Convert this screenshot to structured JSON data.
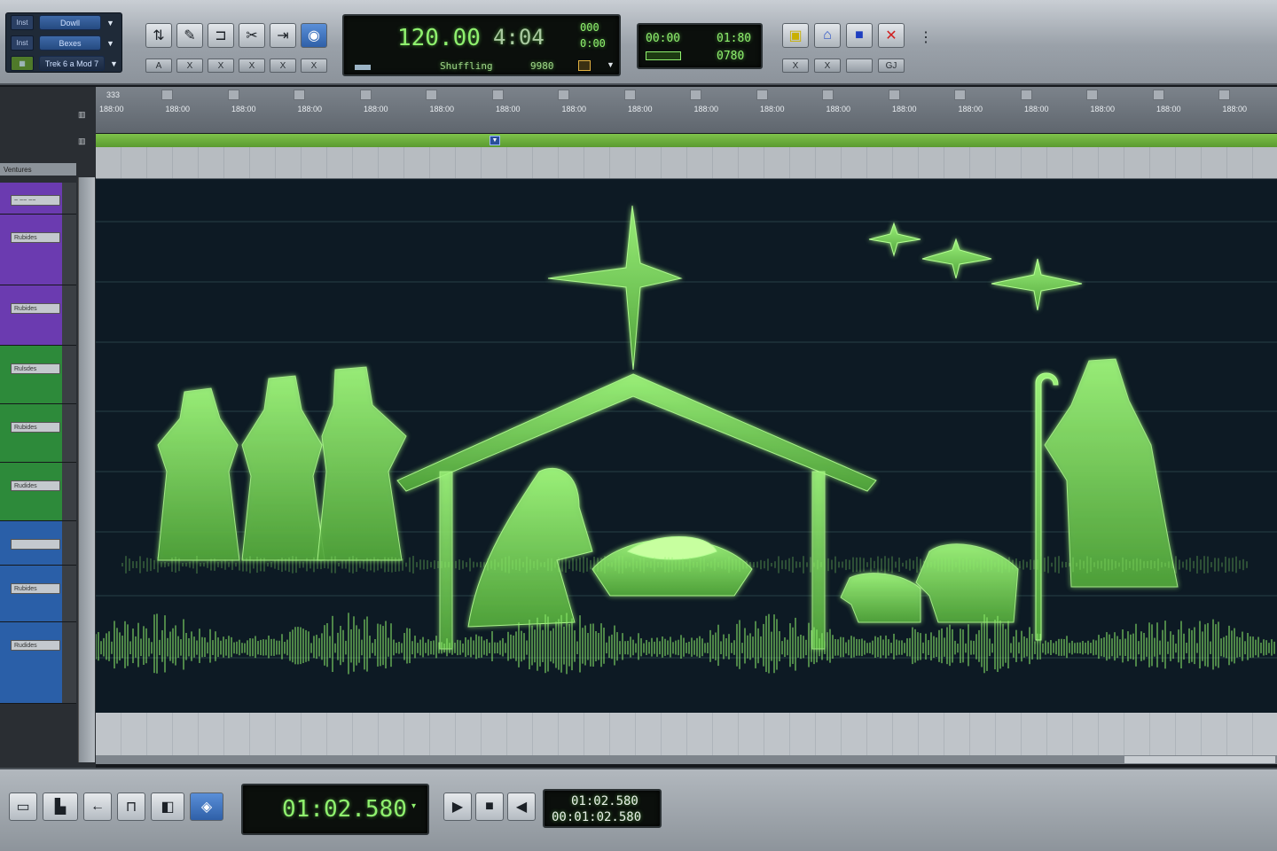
{
  "toolbar": {
    "rows": [
      {
        "tag": "Inst",
        "pill": "Dowll"
      },
      {
        "tag": "Inst",
        "pill": "Bexes"
      },
      {
        "tag": "",
        "pill": "Trek 6 a Mod 7"
      }
    ],
    "tool_icons": [
      "grabber-icon",
      "pencil-icon",
      "trim-icon",
      "scissors-icon",
      "selector-icon",
      "smart-tool-icon"
    ],
    "edit_mode_labels": [
      "A",
      "X",
      "X",
      "X",
      "X",
      "X"
    ],
    "tempo": "120.00",
    "meter": "4:04",
    "counter_top": "000",
    "counter_bottom": "0:00",
    "status_label": "Shuffling",
    "nudge_value": "9980",
    "sel_start": "00:00",
    "sel_end": "01:80",
    "sel_length": "0780",
    "right_buttons": [
      "grid-icon",
      "link-icon",
      "blue-square-icon",
      "tool-x-icon"
    ],
    "right_small": [
      "X",
      "X",
      "",
      "GJ"
    ]
  },
  "ruler": {
    "bar_label": "333",
    "times": [
      "188:00",
      "188:00",
      "188:00",
      "188:00",
      "188:00",
      "188:00",
      "188:00",
      "188:00",
      "188:00",
      "188:00",
      "188:00",
      "188:00",
      "188:00",
      "188:00",
      "188:00",
      "188:00",
      "188:00",
      "188:00"
    ]
  },
  "tracks": {
    "header": "Ventures",
    "items": [
      {
        "name": "~ ~~ ~~",
        "color": "#6b3bb0"
      },
      {
        "name": "Rubides",
        "color": "#6b3bb0"
      },
      {
        "name": "Rubides",
        "color": "#6b3bb0"
      },
      {
        "name": "Rulsdes",
        "color": "#2d8a3a"
      },
      {
        "name": "Rubides",
        "color": "#2d8a3a"
      },
      {
        "name": "Rudides",
        "color": "#2d8a3a"
      },
      {
        "name": "",
        "color": "#2a5fa8"
      },
      {
        "name": "Rubides",
        "color": "#2a5fa8"
      },
      {
        "name": "Rudides",
        "color": "#2a5fa8"
      }
    ]
  },
  "transport": {
    "main_counter": "01:02.580",
    "counter_a": "01:02.580",
    "counter_b": "00:01:02.580",
    "buttons": [
      "window-icon",
      "zoom-icon",
      "back-icon",
      "loop-bracket-icon",
      "scrub-icon",
      "record-blue-icon"
    ],
    "play_buttons": [
      "play-icon",
      "stop-icon",
      "rewind-icon"
    ]
  },
  "colors": {
    "waveform": "#8ff06e",
    "background": "#0d1a24"
  }
}
